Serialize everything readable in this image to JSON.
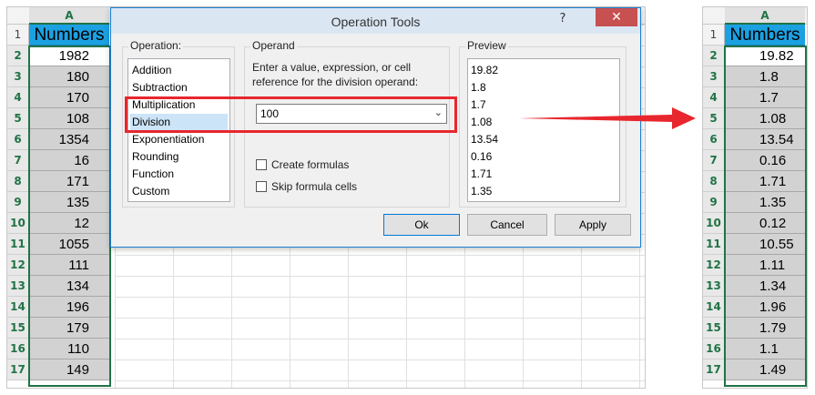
{
  "left_sheet": {
    "column_label": "A",
    "row_numbers": [
      "1",
      "2",
      "3",
      "4",
      "5",
      "6",
      "7",
      "8",
      "9",
      "10",
      "11",
      "12",
      "13",
      "14",
      "15",
      "16",
      "17"
    ],
    "header_cell": "Numbers",
    "values": [
      "1982",
      "180",
      "170",
      "108",
      "1354",
      "16",
      "171",
      "135",
      "12",
      "1055",
      "111",
      "134",
      "196",
      "179",
      "110",
      "149"
    ]
  },
  "right_sheet": {
    "column_label": "A",
    "row_numbers": [
      "1",
      "2",
      "3",
      "4",
      "5",
      "6",
      "7",
      "8",
      "9",
      "10",
      "11",
      "12",
      "13",
      "14",
      "15",
      "16",
      "17"
    ],
    "header_cell": "Numbers",
    "values": [
      "19.82",
      "1.8",
      "1.7",
      "1.08",
      "13.54",
      "0.16",
      "1.71",
      "1.35",
      "0.12",
      "10.55",
      "1.11",
      "1.34",
      "1.96",
      "1.79",
      "1.1",
      "1.49"
    ]
  },
  "dialog": {
    "title": "Operation Tools",
    "help_label": "?",
    "close_label": "✕",
    "operation": {
      "label": "Operation:",
      "items": [
        "Addition",
        "Subtraction",
        "Multiplication",
        "Division",
        "Exponentiation",
        "Rounding",
        "Function",
        "Custom"
      ],
      "selected": "Division"
    },
    "operand": {
      "label": "Operand",
      "description": [
        "Enter a value, expression, or cell",
        "reference for the division operand:"
      ],
      "value": "100"
    },
    "checkboxes": {
      "create_formulas": "Create formulas",
      "skip_formula_cells": "Skip formula cells"
    },
    "preview": {
      "label": "Preview",
      "values": [
        "19.82",
        "1.8",
        "1.7",
        "1.08",
        "13.54",
        "0.16",
        "1.71",
        "1.35"
      ]
    },
    "buttons": {
      "ok": "Ok",
      "cancel": "Cancel",
      "apply": "Apply"
    }
  },
  "colors": {
    "header_fill": "#1ba1e2",
    "excel_green": "#217346",
    "highlight_red": "#e8262d",
    "selected_item": "#cce4f7"
  },
  "icons": {
    "dropdown": "chevron-down-icon",
    "arrow": "right-arrow-icon"
  }
}
